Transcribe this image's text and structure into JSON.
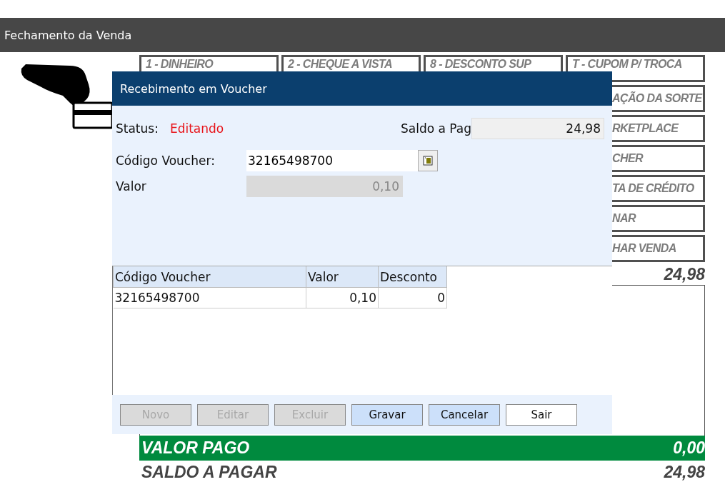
{
  "window": {
    "title": "Fechamento da Venda"
  },
  "payment_buttons": [
    {
      "label": "1 - DINHEIRO"
    },
    {
      "label": "2 - CHEQUE A VISTA"
    },
    {
      "label": "8 - DESCONTO SUP"
    },
    {
      "label": "T - CUPOM P/ TROCA"
    },
    {
      "label": "AÇÃO DA SORTE"
    },
    {
      "label": "RKETPLACE"
    },
    {
      "label": "CHER"
    },
    {
      "label": "TA DE CRÉDITO"
    },
    {
      "label": "NAR"
    },
    {
      "label": "HAR VENDA"
    }
  ],
  "total": "24,98",
  "valor_pago": {
    "label": "VALOR PAGO",
    "value": "0,00"
  },
  "saldo_a_pagar": {
    "label": "SALDO A PAGAR",
    "value": "24,98"
  },
  "dialog": {
    "title": "Recebimento em Voucher",
    "status_label": "Status:",
    "status": "Editando",
    "saldo_label": "Saldo a Pag",
    "saldo_value": "24,98",
    "codigo_label": "Código Voucher:",
    "codigo_value": "32165498700",
    "valor_label": "Valor",
    "valor_value": "0,10",
    "table": {
      "columns": [
        "Código Voucher",
        "Valor",
        "Desconto"
      ],
      "rows": [
        [
          "32165498700",
          "0,10",
          "0"
        ]
      ]
    },
    "buttons": [
      {
        "label": "Novo",
        "disabled": true,
        "highlighted": false
      },
      {
        "label": "Editar",
        "disabled": true,
        "highlighted": false
      },
      {
        "label": "Excluir",
        "disabled": true,
        "highlighted": false
      },
      {
        "label": "Gravar",
        "disabled": false,
        "highlighted": true
      },
      {
        "label": "Cancelar",
        "disabled": false,
        "highlighted": true
      },
      {
        "label": "Sair",
        "disabled": false,
        "highlighted": false
      }
    ]
  }
}
